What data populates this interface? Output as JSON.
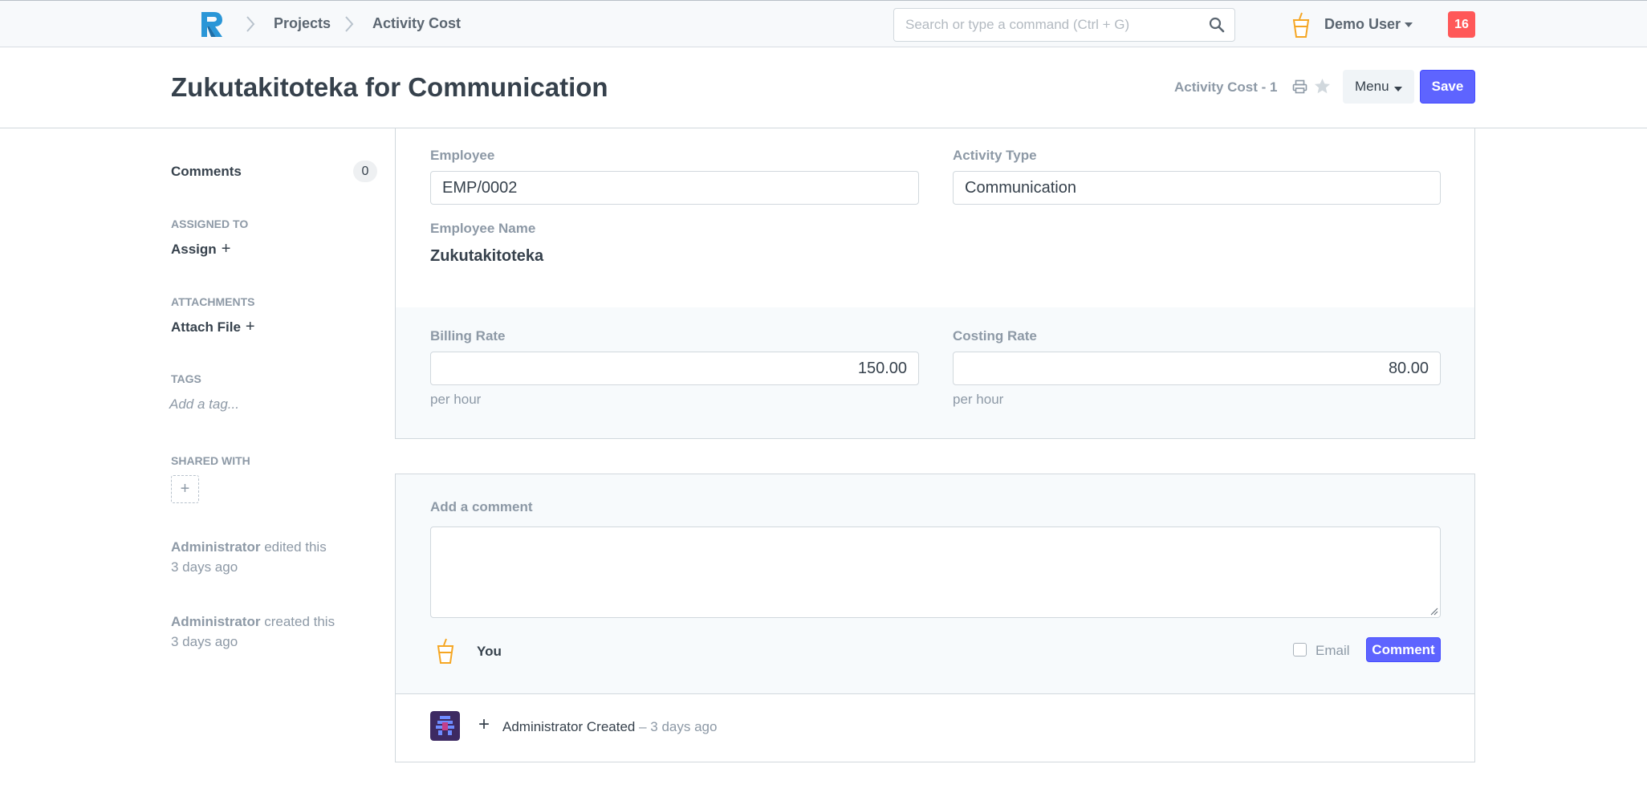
{
  "navbar": {
    "breadcrumbs": [
      "Projects",
      "Activity Cost"
    ],
    "search_placeholder": "Search or type a command (Ctrl + G)",
    "user_name": "Demo User",
    "notification_count": "16",
    "brand_color": "#5e64ff",
    "logo_icon": "erpnext-logo-icon"
  },
  "page_head": {
    "title": "Zukutakitoteka for Communication",
    "doc_name": "Activity Cost - 1",
    "menu_label": "Menu",
    "save_label": "Save"
  },
  "sidebar": {
    "comments_label": "Comments",
    "comments_count": "0",
    "assigned_to_heading": "ASSIGNED TO",
    "assign_label": "Assign",
    "attachments_heading": "ATTACHMENTS",
    "attach_label": "Attach File",
    "tags_heading": "TAGS",
    "tag_placeholder": "Add a tag...",
    "shared_with_heading": "SHARED WITH",
    "plus": "+",
    "timeline": [
      {
        "actor": "Administrator",
        "action": "edited this",
        "when": "3 days ago"
      },
      {
        "actor": "Administrator",
        "action": "created this",
        "when": "3 days ago"
      }
    ]
  },
  "form": {
    "employee": {
      "label": "Employee",
      "value": "EMP/0002"
    },
    "activity_type": {
      "label": "Activity Type",
      "value": "Communication"
    },
    "employee_name": {
      "label": "Employee Name",
      "value": "Zukutakitoteka"
    },
    "billing_rate": {
      "label": "Billing Rate",
      "value": "150.00",
      "help": "per hour"
    },
    "costing_rate": {
      "label": "Costing Rate",
      "value": "80.00",
      "help": "per hour"
    }
  },
  "comments": {
    "add_label": "Add a comment",
    "you_label": "You",
    "email_label": "Email",
    "email_checked": false,
    "comment_button": "Comment",
    "activity": {
      "actor": "Administrator",
      "action": "Created",
      "when": "– 3 days ago"
    }
  },
  "colors": {
    "primary": "#5e64ff",
    "danger": "#ff5858",
    "avatar_orange": "#f5a623"
  }
}
